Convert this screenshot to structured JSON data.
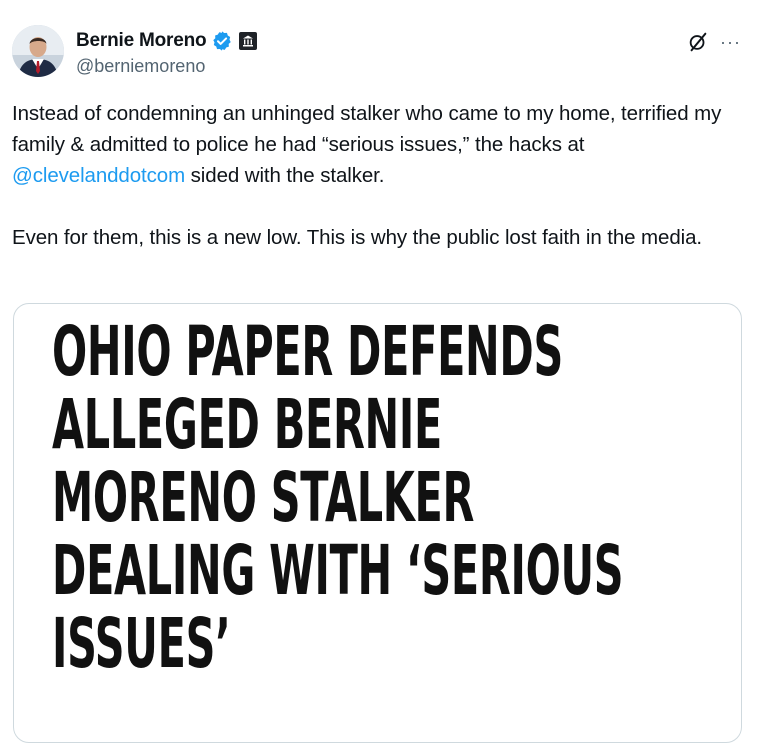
{
  "author": {
    "name": "Bernie Moreno",
    "handle": "@berniemoreno",
    "avatar_icon": "profile-photo",
    "verified_icon": "verified-badge-icon",
    "verified_color": "#1d9bf0",
    "affiliation_icon": "government-building-icon"
  },
  "actions": {
    "grok_icon": "grok-icon",
    "more_label": "···"
  },
  "tweet": {
    "p1_before": "Instead of condemning an unhinged stalker who came to my home, terrified my family & admitted to police he had “serious issues,” the hacks at ",
    "p1_mention": "@clevelanddotcom",
    "p1_after": " sided with the stalker.",
    "p2": "Even for them, this is a new low. This is why the public lost faith in the media.",
    "mention_color": "#1d9bf0"
  },
  "media": {
    "headline_lines": [
      "OHIO PAPER DEFENDS",
      "ALLEGED BERNIE",
      "MORENO STALKER",
      "DEALING WITH ‘SERIOUS",
      "ISSUES’"
    ]
  }
}
